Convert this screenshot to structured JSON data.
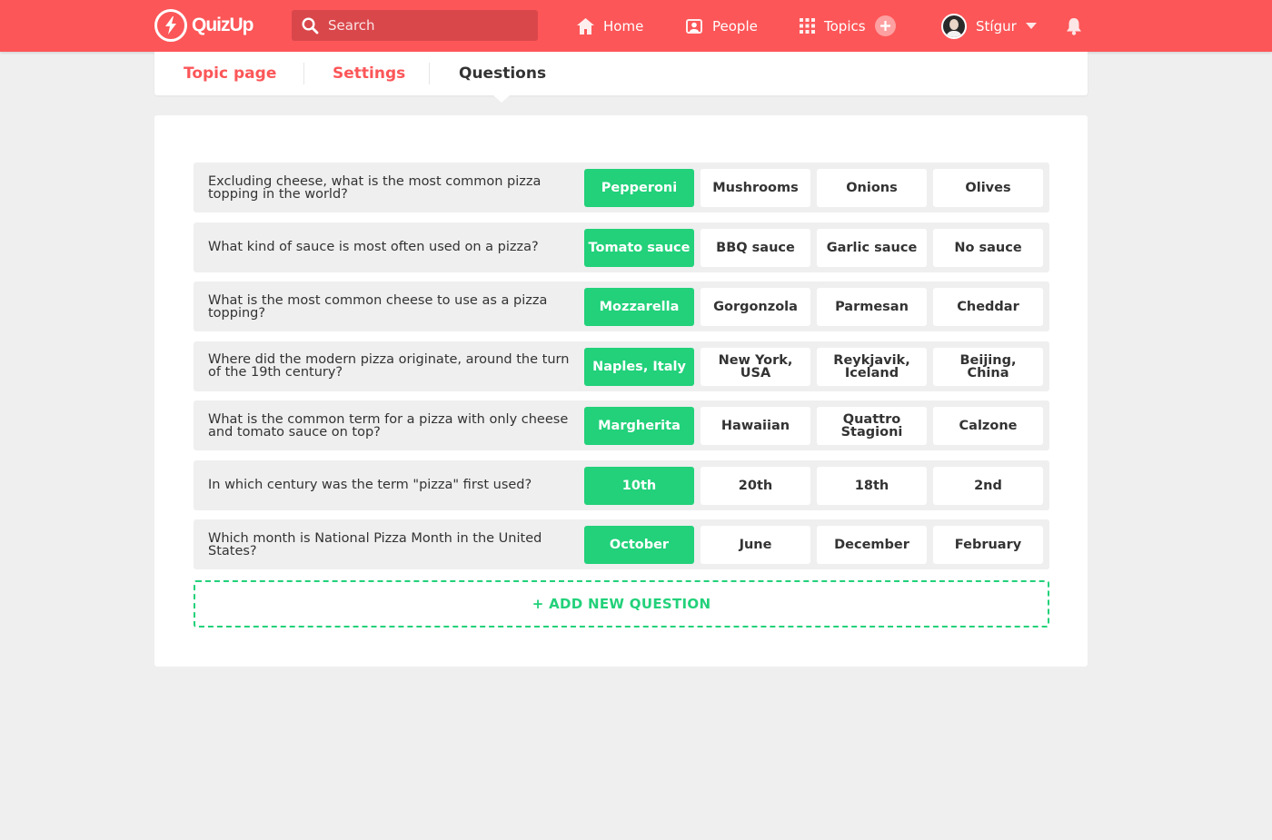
{
  "app": {
    "name": "QuizUp"
  },
  "colors": {
    "brand": "#fc5658",
    "correct": "#22d17a",
    "background": "#efefef"
  },
  "search": {
    "placeholder": "Search"
  },
  "nav": {
    "home": "Home",
    "people": "People",
    "topics": "Topics",
    "user": "Stígur"
  },
  "tabs": {
    "topic_page": "Topic page",
    "settings": "Settings",
    "questions": "Questions",
    "active": "Questions"
  },
  "questions": [
    {
      "text": "Excluding cheese, what is the most common pizza topping in the world?",
      "answers": [
        "Pepperoni",
        "Mushrooms",
        "Onions",
        "Olives"
      ],
      "correct_index": 0
    },
    {
      "text": "What kind of sauce is most often used on a pizza?",
      "answers": [
        "Tomato sauce",
        "BBQ sauce",
        "Garlic sauce",
        "No sauce"
      ],
      "correct_index": 0
    },
    {
      "text": "What is the most common cheese to use as a pizza topping?",
      "answers": [
        "Mozzarella",
        "Gorgonzola",
        "Parmesan",
        "Cheddar"
      ],
      "correct_index": 0
    },
    {
      "text": "Where did the modern pizza originate, around the turn of the 19th century?",
      "answers": [
        "Naples, Italy",
        "New York, USA",
        "Reykjavik, Iceland",
        "Beijing, China"
      ],
      "correct_index": 0
    },
    {
      "text": "What is the common term for a pizza with only cheese and tomato sauce on top?",
      "answers": [
        "Margherita",
        "Hawaiian",
        "Quattro Stagioni",
        "Calzone"
      ],
      "correct_index": 0
    },
    {
      "text": "In which century was the term \"pizza\" first used?",
      "answers": [
        "10th",
        "20th",
        "18th",
        "2nd"
      ],
      "correct_index": 0
    },
    {
      "text": "Which month is National Pizza Month in the United States?",
      "answers": [
        "October",
        "June",
        "December",
        "February"
      ],
      "correct_index": 0
    }
  ],
  "add_question": {
    "label": "+ ADD NEW QUESTION"
  }
}
